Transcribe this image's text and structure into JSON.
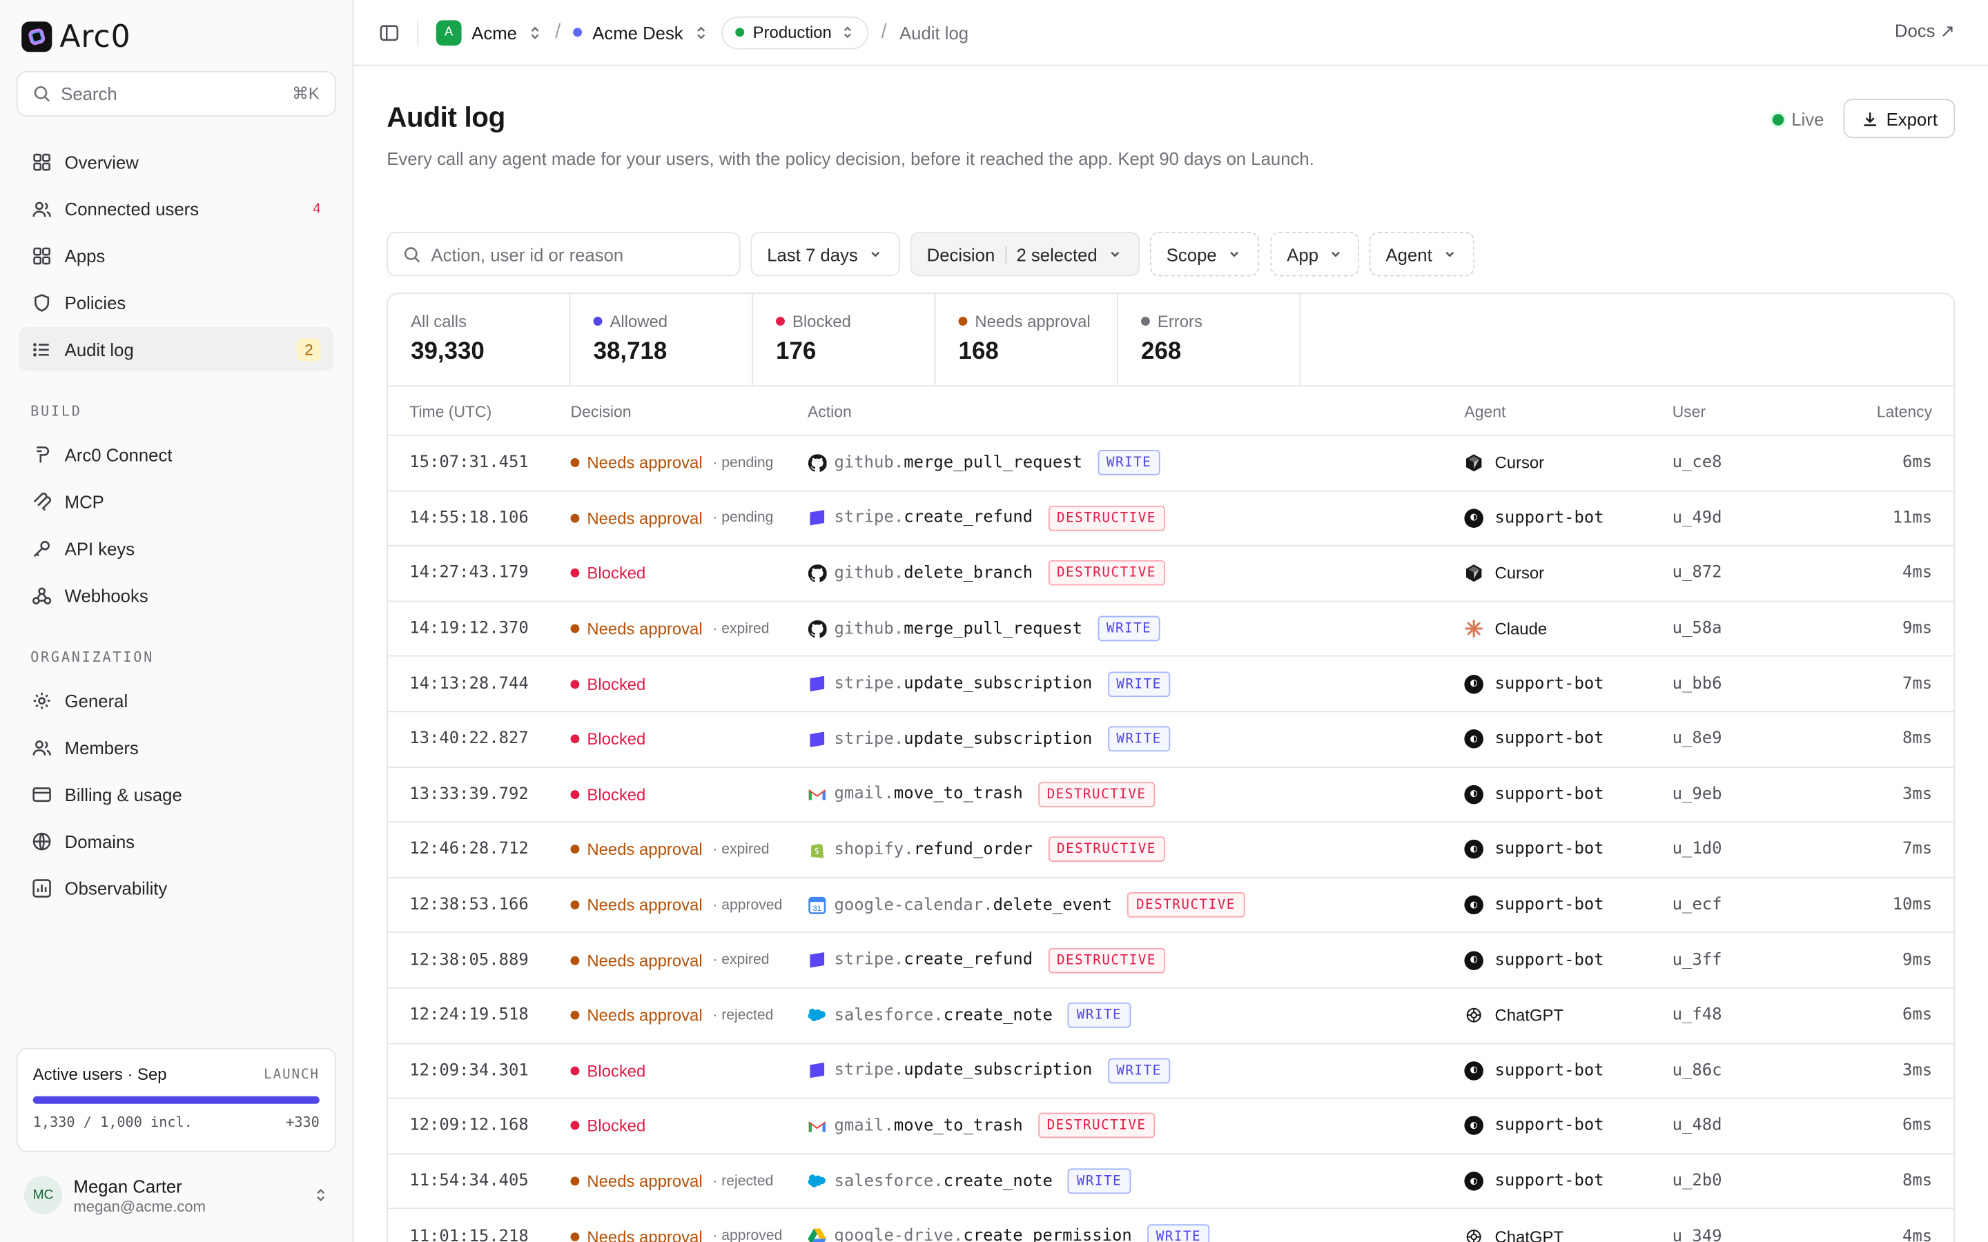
{
  "app": {
    "name": "Arc0"
  },
  "sidebar": {
    "search_placeholder": "Search",
    "search_shortcut": "⌘K",
    "main_items": [
      {
        "label": "Overview",
        "badge": ""
      },
      {
        "label": "Connected users",
        "badge": "4"
      },
      {
        "label": "Apps",
        "badge": ""
      },
      {
        "label": "Policies",
        "badge": ""
      },
      {
        "label": "Audit log",
        "badge": "2"
      }
    ],
    "build_label": "BUILD",
    "build_items": [
      {
        "label": "Arc0 Connect"
      },
      {
        "label": "MCP"
      },
      {
        "label": "API keys"
      },
      {
        "label": "Webhooks"
      }
    ],
    "org_label": "ORGANIZATION",
    "org_items": [
      {
        "label": "General"
      },
      {
        "label": "Members"
      },
      {
        "label": "Billing & usage"
      },
      {
        "label": "Domains"
      },
      {
        "label": "Observability"
      }
    ],
    "usage": {
      "title": "Active users · Sep",
      "plan": "LAUNCH",
      "progress_fraction": 1.0,
      "count": "1,330 / 1,000 incl.",
      "overage": "+330"
    },
    "user": {
      "initials": "MC",
      "name": "Megan Carter",
      "email": "megan@acme.com"
    }
  },
  "topbar": {
    "org_initial": "A",
    "org": "Acme",
    "project": "Acme Desk",
    "environment": "Production",
    "page": "Audit log",
    "docs": "Docs ↗"
  },
  "header": {
    "title": "Audit log",
    "description": "Every call any agent made for your users, with the policy decision, before it reached the app. Kept 90 days on Launch.",
    "live": "Live",
    "export": "Export"
  },
  "filters": {
    "search_placeholder": "Action, user id or reason",
    "range": "Last 7 days",
    "decision_label": "Decision",
    "decision_value": "2 selected",
    "scope": "Scope",
    "app": "App",
    "agent": "Agent"
  },
  "stats": [
    {
      "label": "All calls",
      "value": "39,330",
      "color": ""
    },
    {
      "label": "Allowed",
      "value": "38,718",
      "color": "#4f46e5"
    },
    {
      "label": "Blocked",
      "value": "176",
      "color": "#e11d48"
    },
    {
      "label": "Needs approval",
      "value": "168",
      "color": "#b45309"
    },
    {
      "label": "Errors",
      "value": "268",
      "color": "#71717a"
    }
  ],
  "table": {
    "columns": [
      "Time (UTC)",
      "Decision",
      "Action",
      "Agent",
      "User",
      "Latency"
    ],
    "rows": [
      {
        "time": "15:07:31.451",
        "decision": "Needs approval",
        "sub": "· pending",
        "app": "github",
        "method": "merge_pull_request",
        "tag": "WRITE",
        "agent": "Cursor",
        "user": "u_ce8",
        "latency": "6ms"
      },
      {
        "time": "14:55:18.106",
        "decision": "Needs approval",
        "sub": "· pending",
        "app": "stripe",
        "method": "create_refund",
        "tag": "DESTRUCTIVE",
        "agent": "support-bot",
        "user": "u_49d",
        "latency": "11ms"
      },
      {
        "time": "14:27:43.179",
        "decision": "Blocked",
        "sub": "",
        "app": "github",
        "method": "delete_branch",
        "tag": "DESTRUCTIVE",
        "agent": "Cursor",
        "user": "u_872",
        "latency": "4ms"
      },
      {
        "time": "14:19:12.370",
        "decision": "Needs approval",
        "sub": "· expired",
        "app": "github",
        "method": "merge_pull_request",
        "tag": "WRITE",
        "agent": "Claude",
        "user": "u_58a",
        "latency": "9ms"
      },
      {
        "time": "14:13:28.744",
        "decision": "Blocked",
        "sub": "",
        "app": "stripe",
        "method": "update_subscription",
        "tag": "WRITE",
        "agent": "support-bot",
        "user": "u_bb6",
        "latency": "7ms"
      },
      {
        "time": "13:40:22.827",
        "decision": "Blocked",
        "sub": "",
        "app": "stripe",
        "method": "update_subscription",
        "tag": "WRITE",
        "agent": "support-bot",
        "user": "u_8e9",
        "latency": "8ms"
      },
      {
        "time": "13:33:39.792",
        "decision": "Blocked",
        "sub": "",
        "app": "gmail",
        "method": "move_to_trash",
        "tag": "DESTRUCTIVE",
        "agent": "support-bot",
        "user": "u_9eb",
        "latency": "3ms"
      },
      {
        "time": "12:46:28.712",
        "decision": "Needs approval",
        "sub": "· expired",
        "app": "shopify",
        "method": "refund_order",
        "tag": "DESTRUCTIVE",
        "agent": "support-bot",
        "user": "u_1d0",
        "latency": "7ms"
      },
      {
        "time": "12:38:53.166",
        "decision": "Needs approval",
        "sub": "· approved",
        "app": "google-calendar",
        "method": "delete_event",
        "tag": "DESTRUCTIVE",
        "agent": "support-bot",
        "user": "u_ecf",
        "latency": "10ms"
      },
      {
        "time": "12:38:05.889",
        "decision": "Needs approval",
        "sub": "· expired",
        "app": "stripe",
        "method": "create_refund",
        "tag": "DESTRUCTIVE",
        "agent": "support-bot",
        "user": "u_3ff",
        "latency": "9ms"
      },
      {
        "time": "12:24:19.518",
        "decision": "Needs approval",
        "sub": "· rejected",
        "app": "salesforce",
        "method": "create_note",
        "tag": "WRITE",
        "agent": "ChatGPT",
        "user": "u_f48",
        "latency": "6ms"
      },
      {
        "time": "12:09:34.301",
        "decision": "Blocked",
        "sub": "",
        "app": "stripe",
        "method": "update_subscription",
        "tag": "WRITE",
        "agent": "support-bot",
        "user": "u_86c",
        "latency": "3ms"
      },
      {
        "time": "12:09:12.168",
        "decision": "Blocked",
        "sub": "",
        "app": "gmail",
        "method": "move_to_trash",
        "tag": "DESTRUCTIVE",
        "agent": "support-bot",
        "user": "u_48d",
        "latency": "6ms"
      },
      {
        "time": "11:54:34.405",
        "decision": "Needs approval",
        "sub": "· rejected",
        "app": "salesforce",
        "method": "create_note",
        "tag": "WRITE",
        "agent": "support-bot",
        "user": "u_2b0",
        "latency": "8ms"
      },
      {
        "time": "11:01:15.218",
        "decision": "Needs approval",
        "sub": "· approved",
        "app": "google-drive",
        "method": "create_permission",
        "tag": "WRITE",
        "agent": "ChatGPT",
        "user": "u_349",
        "latency": "4ms"
      }
    ]
  },
  "colors": {
    "needs_approval": "#b45309",
    "blocked": "#e11d48",
    "accent": "#4f46e5",
    "live": "#16a34a"
  }
}
